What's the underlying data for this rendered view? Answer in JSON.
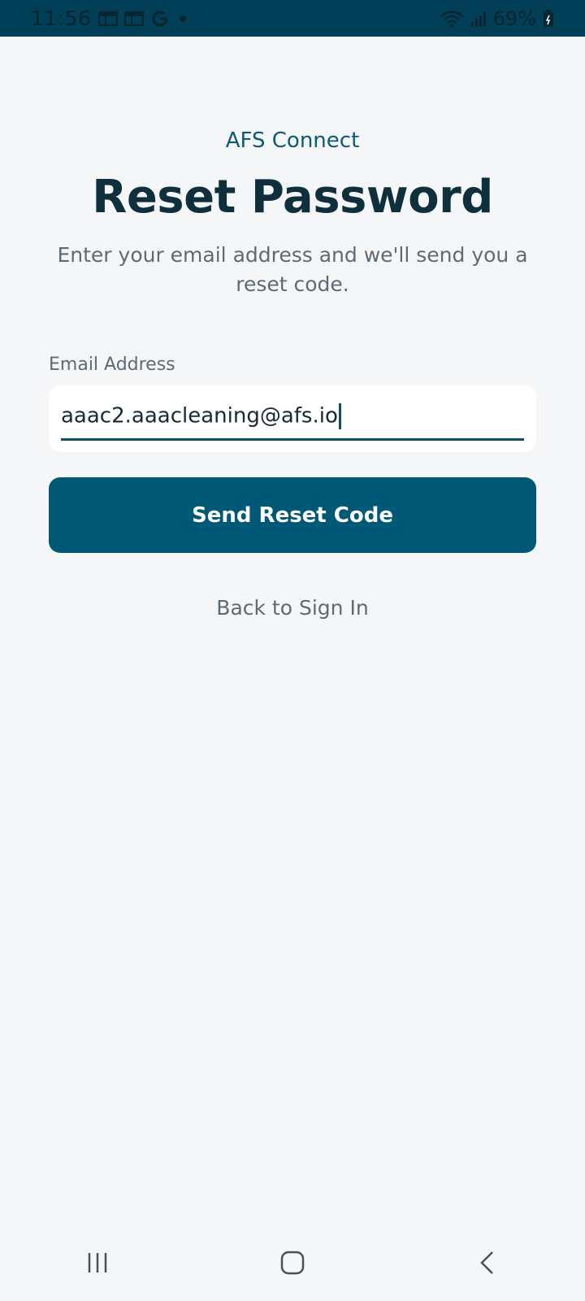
{
  "status_bar": {
    "time": "11:56",
    "battery_percent": "69%",
    "icons": [
      "calendar-icon",
      "calendar-icon",
      "google-icon",
      "dot-icon",
      "wifi-icon",
      "signal-icon",
      "battery-icon"
    ]
  },
  "header": {
    "app_name": "AFS Connect",
    "title": "Reset Password",
    "subtitle": "Enter your email address and we'll send you a reset code."
  },
  "form": {
    "email_label": "Email Address",
    "email_value": "aaac2.aaacleaning@afs.io",
    "submit_label": "Send Reset Code",
    "back_label": "Back to Sign In"
  },
  "colors": {
    "status_bar": "#003f57",
    "primary": "#005877",
    "background": "#f5f6f8",
    "title": "#0f2f3d",
    "muted": "#5e6a74"
  },
  "nav_bar": {
    "buttons": [
      "recent-apps-icon",
      "home-icon",
      "back-icon"
    ]
  }
}
